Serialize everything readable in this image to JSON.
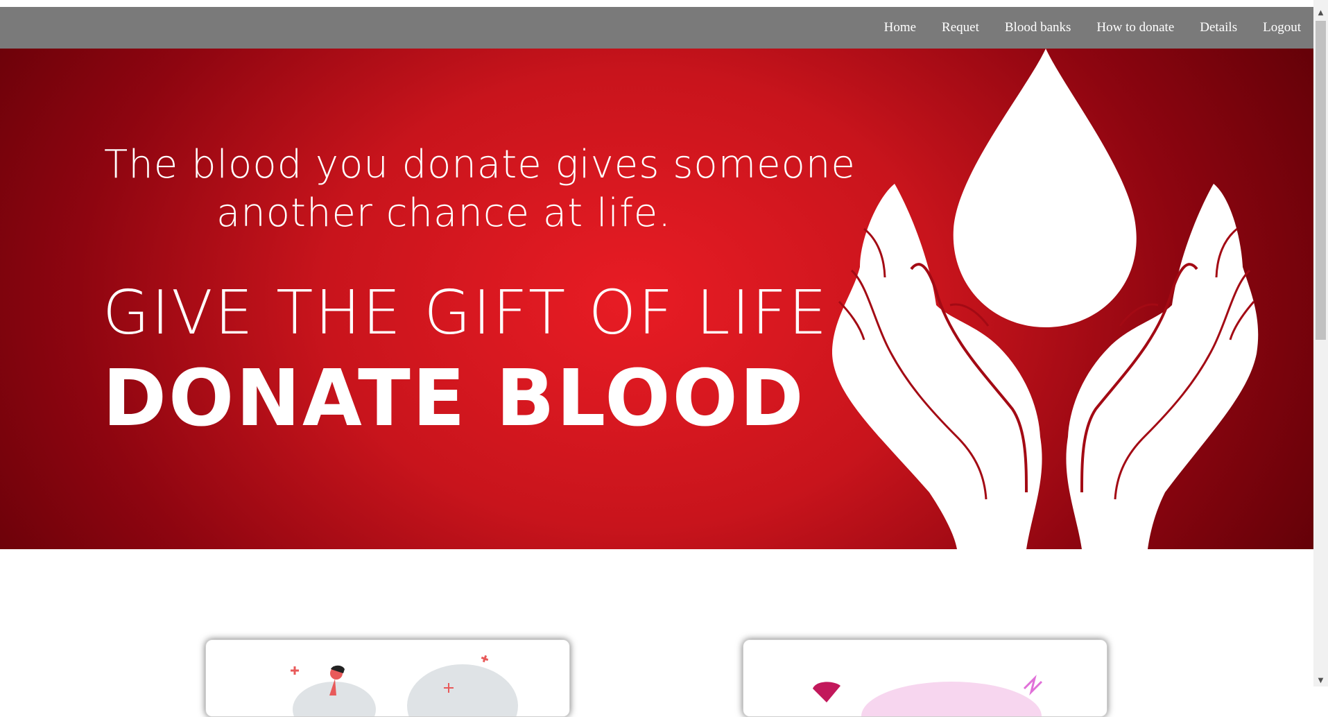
{
  "navbar": {
    "links": [
      "Home",
      "Requet",
      "Blood banks",
      "How to donate",
      "Details",
      "Logout"
    ]
  },
  "hero": {
    "line1": "The blood you donate gives someone",
    "line2": "another chance at life.",
    "give": "GIVE THE GIFT OF LIFE",
    "donate": "DONATE BLOOD",
    "colors": {
      "center": "#e81c24",
      "edge": "#5a0006",
      "text": "#ffffff"
    },
    "art_icons": [
      "blood-drop-icon",
      "cupped-hands-icon"
    ]
  },
  "cards": [
    {
      "name": "donation-illustration-card",
      "icon": "doctor-illustration-icon"
    },
    {
      "name": "heart-illustration-card",
      "icon": "heart-illustration-icon"
    }
  ],
  "scrollbar": {
    "up_arrow": "▲",
    "down_arrow": "▼"
  },
  "colors": {
    "navbar_bg": "#7a7a7a",
    "nav_text": "#ffffff"
  }
}
